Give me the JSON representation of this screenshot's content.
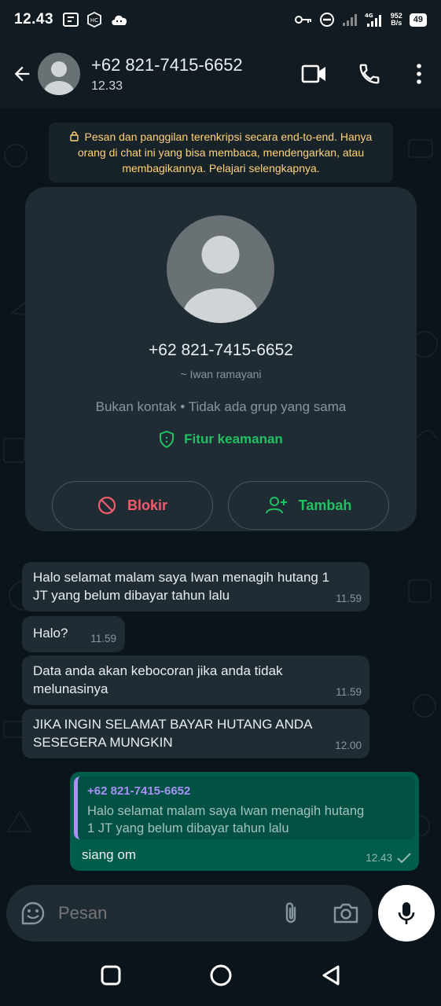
{
  "status_bar": {
    "time": "12.43",
    "network": "4G",
    "speed_value": "952",
    "speed_unit": "B/s",
    "battery": "49"
  },
  "header": {
    "title": "+62 821-7415-6652",
    "subtitle": "12.33"
  },
  "encryption_notice": "Pesan dan panggilan terenkripsi secara end-to-end. Hanya orang di chat ini yang bisa membaca, mendengarkan, atau membagikannya. Pelajari selengkapnya.",
  "contact_card": {
    "phone": "+62 821-7415-6652",
    "alias": "~ Iwan ramayani",
    "info": "Bukan kontak • Tidak ada grup yang sama",
    "security_label": "Fitur keamanan",
    "block_label": "Blokir",
    "add_label": "Tambah"
  },
  "messages": [
    {
      "text_line1": "Halo selamat malam saya Iwan menagih hutang 1",
      "text_line2": "JT yang belum dibayar tahun lalu",
      "time": "11.59"
    },
    {
      "text_line1": "Halo?",
      "time": "11.59"
    },
    {
      "text_line1": "Data anda akan kebocoran jika anda tidak",
      "text_line2": "melunasinya",
      "time": "11.59"
    },
    {
      "text_line1": "JIKA INGIN SELAMAT BAYAR HUTANG ANDA",
      "text_line2": "SESEGERA MUNGKIN",
      "time": "12.00"
    }
  ],
  "reply": {
    "quoted_author": "+62 821-7415-6652",
    "quoted_line1": "Halo selamat malam saya Iwan menagih hutang",
    "quoted_line2": "1 JT yang belum dibayar tahun lalu",
    "text": "siang om",
    "time": "12.43"
  },
  "composer": {
    "placeholder": "Pesan"
  },
  "colors": {
    "accent": "#21c063",
    "danger": "#f15c6d",
    "outgoing_bubble": "#005c4b",
    "incoming_bubble": "#1f2c34",
    "encryption_text": "#ffd279"
  },
  "icons": [
    "back-arrow-icon",
    "video-call-icon",
    "phone-icon",
    "more-vert-icon",
    "lock-icon",
    "shield-icon",
    "block-icon",
    "add-person-icon",
    "emoji-icon",
    "attach-icon",
    "camera-icon",
    "mic-icon",
    "check-icon"
  ]
}
